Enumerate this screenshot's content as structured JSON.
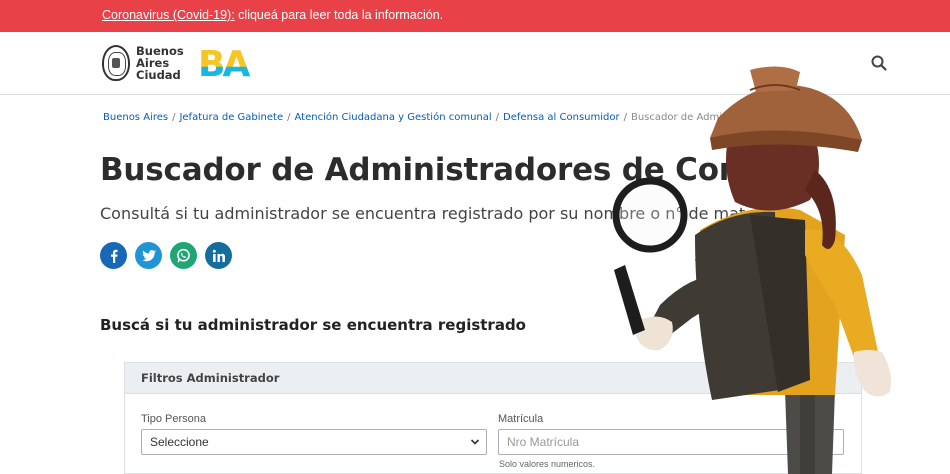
{
  "alert": {
    "link_text": "Coronavirus (Covid-19):",
    "message": " cliqueá para leer toda la información."
  },
  "header": {
    "logo_lines": [
      "Buenos",
      "Aires",
      "Ciudad"
    ],
    "logo_ba": "BA",
    "search_icon": "search-icon"
  },
  "breadcrumb": {
    "items": [
      "Buenos Aires",
      "Jefatura de Gabinete",
      "Atención Ciudadana y Gestión comunal",
      "Defensa al Consumidor"
    ],
    "current": "Buscador de Administradores d"
  },
  "page": {
    "title": "Buscador de Administradores de Consor",
    "subtitle": "Consultá si tu administrador se encuentra registrado por su nombre o n° de mat"
  },
  "share": {
    "icons": [
      "facebook-icon",
      "twitter-icon",
      "whatsapp-icon",
      "linkedin-icon"
    ],
    "colors": [
      "#1868b6",
      "#1f95d6",
      "#20a675",
      "#146d9c"
    ]
  },
  "section": {
    "heading": "Buscá si tu administrador se encuentra registrado"
  },
  "filters": {
    "title": "Filtros Administrador",
    "tipo_persona_label": "Tipo Persona",
    "tipo_persona_value": "Seleccione",
    "matricula_label": "Matrícula",
    "matricula_placeholder": "Nro Matrícula",
    "matricula_help": "Solo valores numericos."
  },
  "colors": {
    "alert_bg": "#e84248",
    "link": "#0a5bb8",
    "ba_yellow": "#f7c625",
    "ba_cyan": "#18b7e0"
  }
}
